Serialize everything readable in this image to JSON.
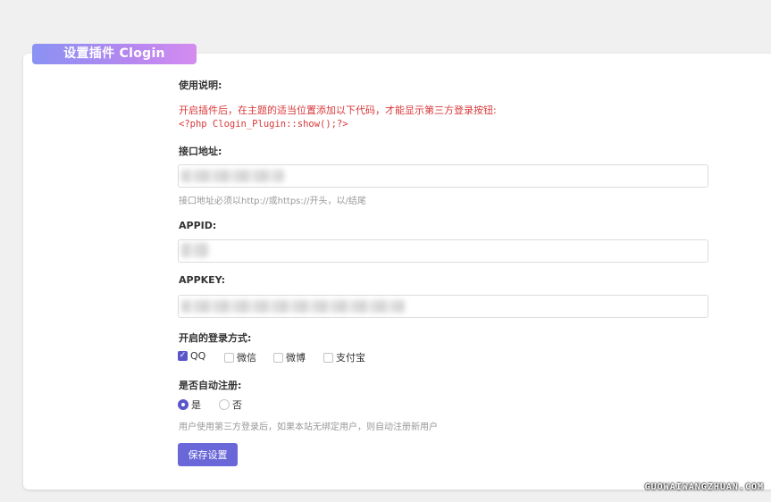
{
  "header": {
    "title": "设置插件 Clogin"
  },
  "usage": {
    "label": "使用说明:",
    "notice": "开启插件后，在主题的适当位置添加以下代码，才能显示第三方登录按钮:",
    "code": "<?php Clogin_Plugin::show();?>"
  },
  "api_url": {
    "label": "接口地址:",
    "hint": "接口地址必须以http://或https://开头，以/结尾"
  },
  "appid": {
    "label": "APPID:"
  },
  "appkey": {
    "label": "APPKEY:"
  },
  "login_methods": {
    "label": "开启的登录方式:",
    "options": [
      {
        "label": "QQ",
        "checked": true
      },
      {
        "label": "微信",
        "checked": false
      },
      {
        "label": "微博",
        "checked": false
      },
      {
        "label": "支付宝",
        "checked": false
      }
    ]
  },
  "auto_register": {
    "label": "是否自动注册:",
    "options": [
      {
        "label": "是",
        "selected": true
      },
      {
        "label": "否",
        "selected": false
      }
    ],
    "hint": "用户使用第三方登录后，如果本站无绑定用户，则自动注册新用户"
  },
  "actions": {
    "save_label": "保存设置"
  },
  "watermark": "GUOWAIWANGZHUAN.COM",
  "colors": {
    "accent": "#6a67d8",
    "notice": "#d9383a"
  }
}
